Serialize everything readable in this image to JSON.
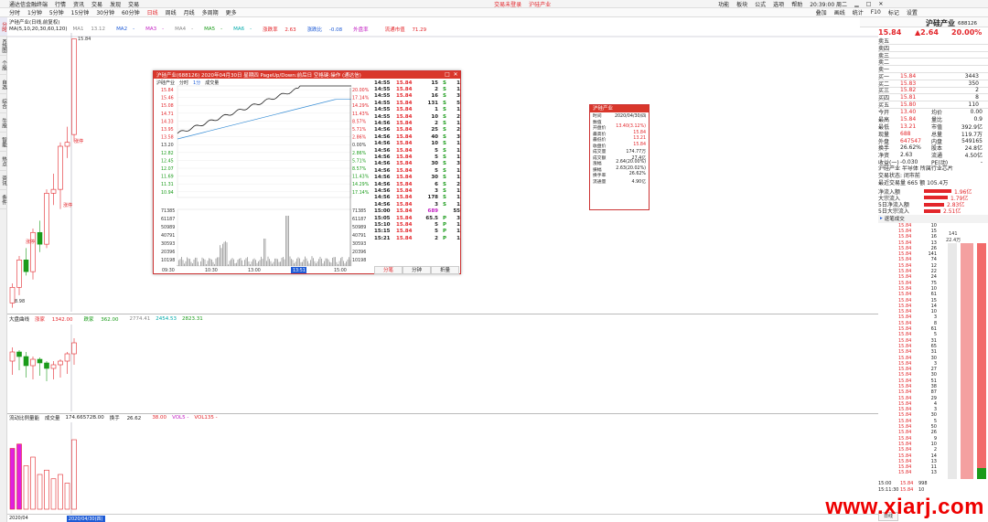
{
  "titlebar": {
    "app": "通达信金融终端",
    "menus": [
      "行情",
      "资讯",
      "交易",
      "发现",
      "交易"
    ],
    "center_alert": "交易未登录",
    "center_stock": "沪硅产业",
    "right_items": [
      "功能",
      "板块",
      "公式",
      "选项",
      "帮助"
    ],
    "time": "20:39:00 周二"
  },
  "toolbar": {
    "items": [
      "分时",
      "1分钟",
      "5分钟",
      "15分钟",
      "30分钟",
      "60分钟",
      "日线",
      "周线",
      "月线",
      "多周期",
      "更多"
    ],
    "right_items": [
      "叠加",
      "画线",
      "统计",
      "F10",
      "标记",
      "设置"
    ]
  },
  "sidebar": [
    "分时图",
    "K线图",
    "个股资料",
    "自选股",
    "综合排名",
    "牛股",
    "智能选股",
    "热点",
    "资讯",
    "条件"
  ],
  "kline": {
    "header_left": "沪硅产业(日线,前复权)",
    "ma_label": "MA(5,10,20,30,60,120)",
    "ma_values": [
      {
        "name": "MA1",
        "value": "13.12"
      },
      {
        "name": "MA2",
        "value": "-"
      },
      {
        "name": "MA3",
        "value": "-"
      },
      {
        "name": "MA4",
        "value": "-"
      },
      {
        "name": "MA5",
        "value": "-"
      },
      {
        "name": "MA6",
        "value": "-"
      }
    ],
    "extra": [
      {
        "label": "涨跌率",
        "value": "2.63"
      },
      {
        "label": "涨跌比",
        "value": "-0.08"
      },
      {
        "label": "外盘率",
        "value": ""
      },
      {
        "label": "流通市值",
        "value": "71.29"
      }
    ],
    "high_label": "15.84",
    "low_label": "8.98",
    "annotations": [
      "涨停",
      "涨停",
      "涨停"
    ],
    "axis": [
      "15.84",
      "15.50",
      "15.25",
      "15.00",
      "14.75",
      "14.50",
      "14.25",
      "14.00",
      "13.75",
      "13.50",
      "13.25",
      "13.00",
      "12.75",
      "12.50",
      "12.25",
      "12.00",
      "11.75",
      "11.50",
      "11.25",
      "11.00",
      "10.75",
      "10.50",
      "10.25",
      "10.00",
      "9.75",
      "9.50",
      "9.25",
      "9.00"
    ]
  },
  "index": {
    "name": "大盘曲线",
    "v1_label": "涨家",
    "v1": "1342.00",
    "v2_label": "跌家",
    "v2": "362.00",
    "v3": "2774.41",
    "v4": "2454.53",
    "v5": "2823.31",
    "axis": [
      "2900",
      "2860",
      "2820",
      "2780",
      "2740"
    ]
  },
  "volume": {
    "name": "流动比例量能",
    "label1": "成交量",
    "vol": "174.66572B.00",
    "turn_label": "换手",
    "turn": "26.62",
    "v2": "38.00",
    "vol5": "VOL5 -",
    "vol10": "VOL135 -",
    "axis": [
      "20000",
      "15000",
      "10000",
      "5000",
      "0",
      "万股"
    ],
    "dates": [
      "2020/04",
      "2020/04/30(四)"
    ]
  },
  "popup": {
    "title": "沪硅产业(688126) 2020年04月30日 星期四 PageUp/Down:前后日 空格键:操作 (通达信)",
    "tabs": [
      "沪硅产业",
      "分时",
      "1分",
      "成交量"
    ],
    "price_axis": [
      "15.84",
      "15.46",
      "15.08",
      "14.71",
      "14.33",
      "13.95",
      "13.58",
      "13.20",
      "12.82",
      "12.45",
      "12.07",
      "11.69",
      "11.31",
      "10.94"
    ],
    "pct_axis": [
      "20.00%",
      "17.14%",
      "14.29%",
      "11.43%",
      "8.57%",
      "5.71%",
      "2.86%",
      "0.00%",
      "2.86%",
      "5.71%",
      "8.57%",
      "11.43%",
      "14.29%",
      "17.14%"
    ],
    "vol_axis": [
      "71385",
      "61187",
      "50989",
      "40791",
      "30593",
      "20396",
      "10198"
    ],
    "time_axis": [
      "09:30",
      "10:30",
      "13:00",
      "14:00",
      "15:00"
    ],
    "time_marker": "13:51",
    "ticks": [
      {
        "t": "14:55",
        "p": "15.84",
        "v": "15",
        "s": "S",
        "n": "1"
      },
      {
        "t": "14:55",
        "p": "15.84",
        "v": "2",
        "s": "S",
        "n": "1"
      },
      {
        "t": "14:55",
        "p": "15.84",
        "v": "16",
        "s": "S",
        "n": "3"
      },
      {
        "t": "14:55",
        "p": "15.84",
        "v": "131",
        "s": "S",
        "n": "5"
      },
      {
        "t": "14:55",
        "p": "15.84",
        "v": "1",
        "s": "S",
        "n": "1"
      },
      {
        "t": "14:55",
        "p": "15.84",
        "v": "10",
        "s": "S",
        "n": "2"
      },
      {
        "t": "14:56",
        "p": "15.84",
        "v": "2",
        "s": "S",
        "n": "1"
      },
      {
        "t": "14:56",
        "p": "15.84",
        "v": "25",
        "s": "S",
        "n": "2"
      },
      {
        "t": "14:56",
        "p": "15.84",
        "v": "40",
        "s": "S",
        "n": "3"
      },
      {
        "t": "14:56",
        "p": "15.84",
        "v": "10",
        "s": "S",
        "n": "1"
      },
      {
        "t": "14:56",
        "p": "15.84",
        "v": "5",
        "s": "S",
        "n": "1"
      },
      {
        "t": "14:56",
        "p": "15.84",
        "v": "5",
        "s": "S",
        "n": "1"
      },
      {
        "t": "14:56",
        "p": "15.84",
        "v": "30",
        "s": "S",
        "n": "3"
      },
      {
        "t": "14:56",
        "p": "15.84",
        "v": "5",
        "s": "S",
        "n": "1"
      },
      {
        "t": "14:56",
        "p": "15.84",
        "v": "30",
        "s": "S",
        "n": "1"
      },
      {
        "t": "14:56",
        "p": "15.84",
        "v": "6",
        "s": "S",
        "n": "2"
      },
      {
        "t": "14:56",
        "p": "15.84",
        "v": "3",
        "s": "S",
        "n": "1"
      },
      {
        "t": "14:56",
        "p": "15.84",
        "v": "178",
        "s": "S",
        "n": "1"
      },
      {
        "t": "14:56",
        "p": "15.84",
        "v": "3",
        "s": "S",
        "n": "1"
      },
      {
        "t": "15:00",
        "p": "15.84",
        "v": "689",
        "s": "",
        "n": "55"
      },
      {
        "t": "15:05",
        "p": "15.84",
        "v": "65.5",
        "s": "P",
        "n": "3"
      },
      {
        "t": "15:10",
        "p": "15.84",
        "v": "5",
        "s": "P",
        "n": "1"
      },
      {
        "t": "15:15",
        "p": "15.84",
        "v": "5",
        "s": "P",
        "n": "1"
      },
      {
        "t": "15:21",
        "p": "15.84",
        "v": "2",
        "s": "P",
        "n": "1"
      }
    ],
    "bottom_tabs": [
      "分笔",
      "分钟",
      "折量"
    ]
  },
  "infobox": {
    "title": "沪硅产业",
    "rows": [
      {
        "k": "时间",
        "v": "2020/04/30/四"
      },
      {
        "k": "数值",
        "v": ""
      },
      {
        "k": "开盘价",
        "v": "13.40(3.12%)"
      },
      {
        "k": "最高价",
        "v": "15.84"
      },
      {
        "k": "最低价",
        "v": "13.21"
      },
      {
        "k": "收盘价",
        "v": "15.84"
      },
      {
        "k": "成交量",
        "v": "174.77万"
      },
      {
        "k": "成交额",
        "v": "27.4亿"
      },
      {
        "k": "涨幅",
        "v": "2.64(20.00%)"
      },
      {
        "k": "振幅",
        "v": "2.63(20.02%)"
      },
      {
        "k": "换手率",
        "v": "26.62%"
      },
      {
        "k": "流通量",
        "v": "4.90亿"
      }
    ]
  },
  "quote": {
    "name": "沪硅产业",
    "code": "688126",
    "price": "15.84",
    "change": "▲2.64",
    "pct": "20.00%",
    "sells": [
      {
        "l": "卖五",
        "p": "",
        "v": ""
      },
      {
        "l": "卖四",
        "p": "",
        "v": ""
      },
      {
        "l": "卖三",
        "p": "",
        "v": ""
      },
      {
        "l": "卖二",
        "p": "",
        "v": ""
      },
      {
        "l": "卖一",
        "p": "",
        "v": ""
      }
    ],
    "buys": [
      {
        "l": "买一",
        "p": "15.84",
        "v": "3443"
      },
      {
        "l": "买二",
        "p": "15.83",
        "v": "350"
      },
      {
        "l": "买三",
        "p": "15.82",
        "v": "2"
      },
      {
        "l": "买四",
        "p": "15.81",
        "v": "8"
      },
      {
        "l": "买五",
        "p": "15.80",
        "v": "110"
      }
    ],
    "stats": [
      {
        "k": "今开",
        "v": "13.40",
        "k2": "均价",
        "v2": "0.00"
      },
      {
        "k": "最高",
        "v": "15.84",
        "k2": "量比",
        "v2": "0.9"
      },
      {
        "k": "最低",
        "v": "13.21",
        "k2": "市值",
        "v2": "392.9亿"
      },
      {
        "k": "现量",
        "v": "688",
        "k2": "总量",
        "v2": "119.7万"
      },
      {
        "k": "外盘",
        "v": "647547",
        "k2": "内盘",
        "v2": "549165"
      },
      {
        "k": "换手",
        "v": "26.62%",
        "k2": "股本",
        "v2": "24.8亿"
      },
      {
        "k": "净资",
        "v": "2.63",
        "k2": "流通",
        "v2": "4.50亿"
      },
      {
        "k": "收益(一)",
        "v": "-0.030",
        "k2": "PE(动)",
        "v2": "-"
      }
    ],
    "info_lines": [
      "沪硅产业 半导体 所属行业芯片",
      "交易状态: 闭市前 ",
      "最近交易量 665 额 105.4万"
    ],
    "flows": [
      {
        "k": "净流入额",
        "v": "1.96亿"
      },
      {
        "k": "大宗流入",
        "v": "1.79亿"
      },
      {
        "k": "5日净流入额",
        "v": "2.83亿"
      },
      {
        "k": "5日大宗流入",
        "v": "2.51亿"
      }
    ],
    "deals_title": "逐笔成交",
    "deals_scale": [
      "141",
      "22.4万"
    ],
    "deal_price": "15.84",
    "deal_vols": [
      "10",
      "15",
      "16",
      "13",
      "26",
      "141",
      "74",
      "12",
      "22",
      "24",
      "75",
      "10",
      "61",
      "15",
      "14",
      "10",
      "3",
      "8",
      "61",
      "5",
      "31",
      "65",
      "31",
      "30",
      "3",
      "27",
      "30",
      "51",
      "38",
      "87",
      "29",
      "4",
      "3",
      "30",
      "5",
      "50",
      "26",
      "9",
      "10",
      "2",
      "14",
      "13",
      "11",
      "13"
    ],
    "bottom_time": "15:00",
    "bottom_vol": "998",
    "bottom_rows": [
      {
        "t": "15:11:30",
        "p": "15.84",
        "v": "10"
      }
    ],
    "side_label": "日线"
  },
  "colors": {
    "up": "#e3262b",
    "down": "#1a9b1a",
    "accent": "#d9372b",
    "ma_blue": "#1e5bd6"
  },
  "watermark": "www.xiarj.com"
}
